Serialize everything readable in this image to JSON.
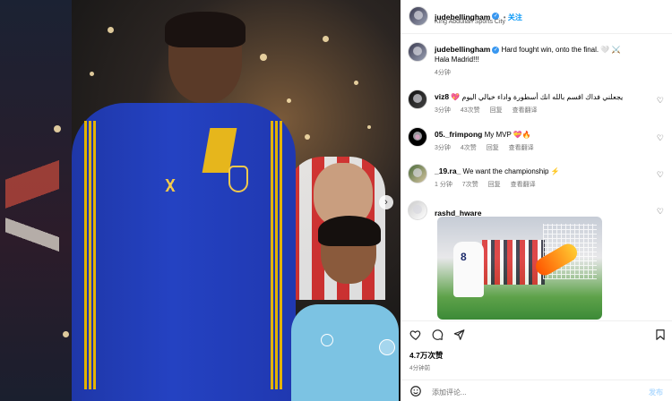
{
  "post": {
    "author": "judebellingham",
    "follow_label": "关注",
    "location": "King Abdullah Sports City",
    "caption_author": "judebellingham",
    "caption_line1": "Hard fought win, onto the final. 🤍 ⚔️",
    "caption_line2": "Hala Madrid!!!",
    "caption_time": "4分钟"
  },
  "comments": [
    {
      "user": "viz8",
      "text": "يجعلني فداك اقسم بالله انك أسطورة واداء خيالي اليوم 💖",
      "time": "3分钟",
      "likes": "43次赞",
      "reply": "回复",
      "translate": "查看翻译"
    },
    {
      "user": "05._frimpong",
      "text": "My MVP 💝🔥",
      "time": "3分钟",
      "likes": "4次赞",
      "reply": "回复",
      "translate": "查看翻译"
    },
    {
      "user": "_19.ra_",
      "text": "We want the championship ⚡",
      "time": "1 分钟",
      "likes": "7次赞",
      "reply": "回复",
      "translate": "查看翻译"
    },
    {
      "user": "rashd_hware",
      "sticker_number": "8"
    }
  ],
  "engagement": {
    "likes": "4.7万次赞",
    "time": "4分钟前"
  },
  "composer": {
    "placeholder": "添加评论...",
    "post_label": "发布"
  },
  "icons": {
    "like": "heart-icon",
    "comment": "comment-icon",
    "share": "send-icon",
    "save": "bookmark-icon",
    "emoji": "emoji-icon",
    "next": "chevron-right-icon"
  },
  "colors": {
    "accent": "#0095f6",
    "verified": "#3897f0"
  }
}
